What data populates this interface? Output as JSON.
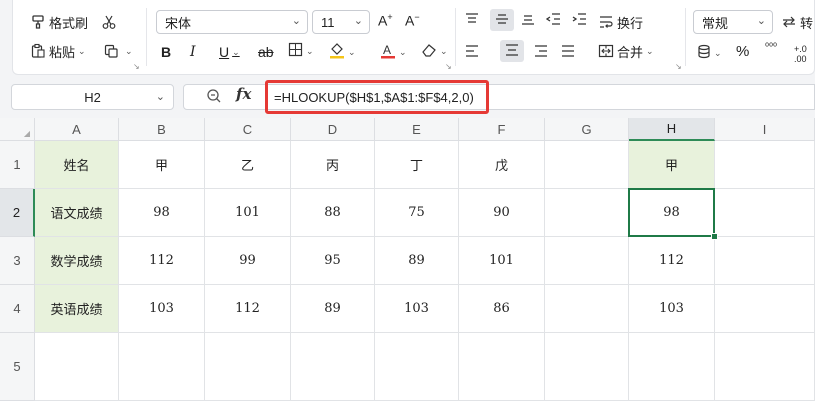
{
  "ribbon": {
    "format_painter": "格式刷",
    "paste": "粘贴",
    "font_name": "宋体",
    "font_size": "11",
    "wrap_text": "换行",
    "merge": "合并",
    "number_format": "常规",
    "convert": "转"
  },
  "formula_bar": {
    "name_box": "H2",
    "fx": "fx",
    "formula": "=HLOOKUP($H$1,$A$1:$F$4,2,0)"
  },
  "sheet": {
    "columns": [
      "A",
      "B",
      "C",
      "D",
      "E",
      "F",
      "G",
      "H",
      "I"
    ],
    "rows": [
      "1",
      "2",
      "3",
      "4",
      "5"
    ],
    "cells": [
      [
        "姓名",
        "甲",
        "乙",
        "丙",
        "丁",
        "戊",
        "",
        "甲",
        ""
      ],
      [
        "语文成绩",
        "98",
        "101",
        "88",
        "75",
        "90",
        "",
        "98",
        ""
      ],
      [
        "数学成绩",
        "112",
        "99",
        "95",
        "89",
        "101",
        "",
        "112",
        ""
      ],
      [
        "英语成绩",
        "103",
        "112",
        "89",
        "103",
        "86",
        "",
        "103",
        ""
      ],
      [
        "",
        "",
        "",
        "",
        "",
        "",
        "",
        "",
        ""
      ]
    ],
    "active_cell": "H2"
  },
  "colors": {
    "header_fill": "#e8f2dc",
    "selection": "#1f7a47",
    "highlight_border": "#e53935"
  }
}
